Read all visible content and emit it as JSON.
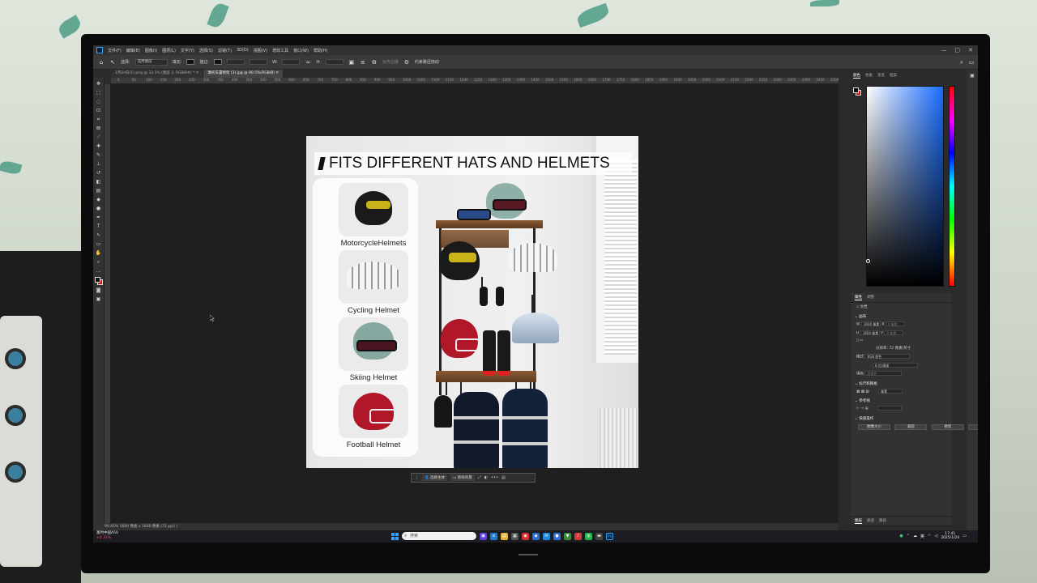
{
  "photoshop": {
    "menu": [
      "文件(F)",
      "编辑(E)",
      "图像(I)",
      "图层(L)",
      "文字(Y)",
      "选择(S)",
      "滤镜(T)",
      "3D(D)",
      "视图(V)",
      "增效工具",
      "窗口(W)",
      "帮助(H)"
    ],
    "window_controls": [
      "—",
      "▢",
      "✕"
    ],
    "options": {
      "select_label": "选择:",
      "select_value": "选用图层",
      "fill_label": "填充:",
      "stroke_label": "描边:",
      "w_label": "W:",
      "h_label": "H:",
      "align_label": "对齐边缘",
      "constrain_label": "约束路径拖动"
    },
    "tabs": [
      {
        "label": "1月24日(1).png @ 33.1% (图层 2, RGB/8#) *",
        "active": false
      },
      {
        "label": "摩托车置物架 (3).jpg @ 90.5%(RGB/8)",
        "active": true
      }
    ],
    "ruler_ticks": [
      "0",
      "50",
      "100",
      "150",
      "200",
      "250",
      "300",
      "350",
      "400",
      "450",
      "500",
      "550",
      "600",
      "650",
      "700",
      "750",
      "800",
      "850",
      "900",
      "950",
      "1000",
      "1050",
      "1100",
      "1150",
      "1200",
      "1250",
      "1300",
      "1350",
      "1400",
      "1450",
      "1500",
      "1550",
      "1600",
      "1650",
      "1700",
      "1750",
      "1800",
      "1850",
      "1900",
      "1950",
      "2000",
      "2050",
      "2100",
      "2150",
      "2200",
      "2250",
      "2300",
      "2350",
      "2400",
      "2450",
      "2500"
    ],
    "status": "90.45%    1600 像素 x 1600 像素 (72 ppi)    〉",
    "context_bar": {
      "select_subject": "选择主体",
      "remove_bg": "移除背景"
    }
  },
  "document": {
    "title": "FITS DIFFERENT HATS AND HELMETS",
    "cards": [
      {
        "label": "MotorcycleHelmets"
      },
      {
        "label": "Cycling Helmet"
      },
      {
        "label": "Skiing Helmet"
      },
      {
        "label": "Football Helmet"
      }
    ]
  },
  "panels": {
    "color_tabs": [
      "颜色",
      "色板",
      "渐变",
      "图案"
    ],
    "props_tabs": [
      "属性",
      "调整"
    ],
    "doc_label": "文档",
    "canvas_head": "画布",
    "w_label": "W",
    "w_value": "1600 像素",
    "h_label": "H",
    "h_value": "1600 像素",
    "x_label": "X",
    "x_value": "0 像素",
    "y_label": "Y",
    "y_value": "0 像素",
    "resolution": "分辨率: 72 像素/英寸",
    "mode_label": "模式",
    "mode_value": "RGB 颜色",
    "depth_value": "8 位/通道",
    "fill_label": "填色",
    "fill_value": "背景色",
    "rulers_head": "标尺和网格",
    "unit_value": "像素",
    "guides_head": "参考线",
    "quick_head": "快速操作",
    "quick_actions": [
      "图像大小",
      "裁剪",
      "修剪",
      "旋转"
    ],
    "bottom_tabs": [
      "图层",
      "通道",
      "路径"
    ]
  },
  "taskbar": {
    "stock_name": "富时中国A50",
    "stock_change": "+0.31%",
    "search_placeholder": "搜索",
    "lang": "英",
    "time": "17:41",
    "date": "2025/1/24"
  },
  "colors": {
    "foreground": "#0b0b0b",
    "background": "#e01010",
    "accent": "#2fa3f6"
  }
}
